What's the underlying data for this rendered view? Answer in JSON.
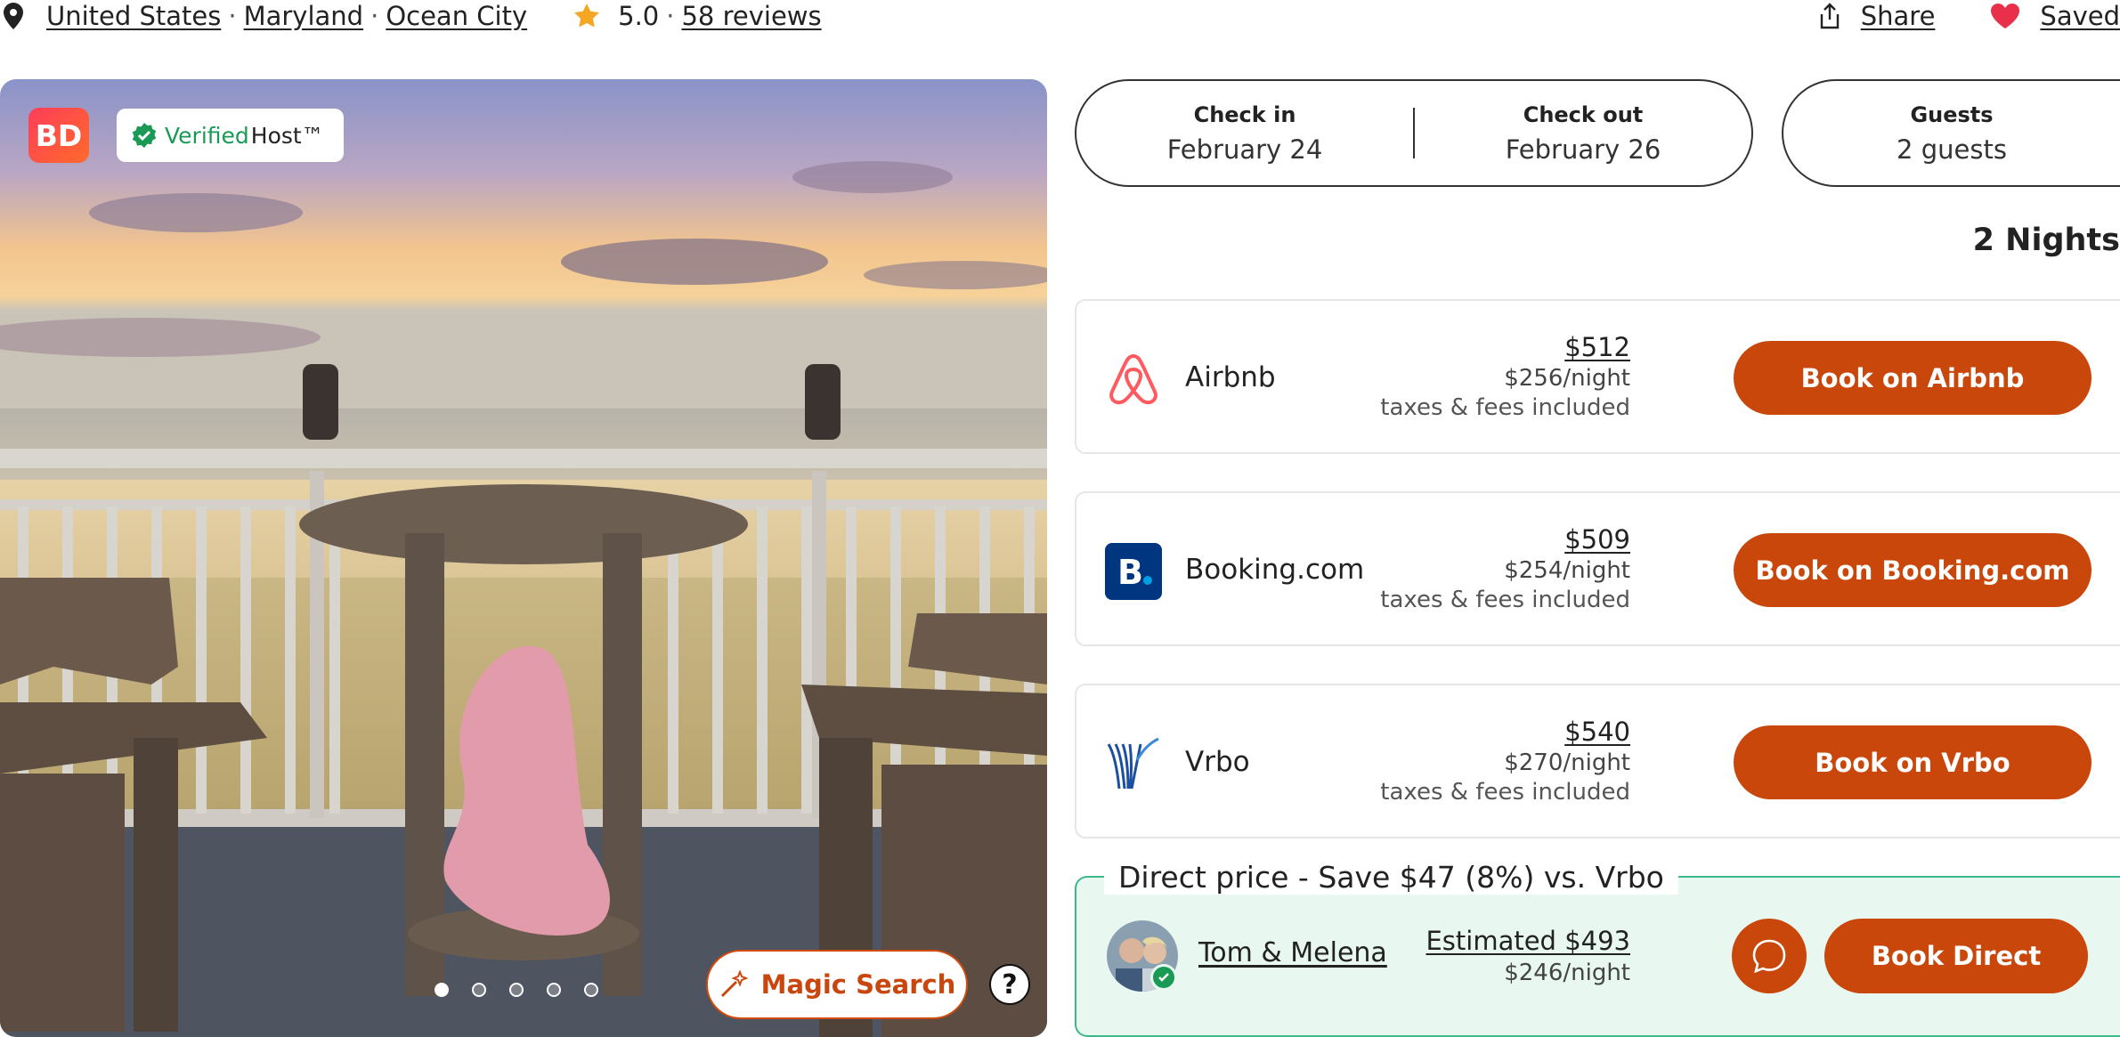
{
  "location": {
    "country": "United States",
    "state": "Maryland",
    "city": "Ocean City",
    "separator": "·"
  },
  "rating": {
    "score": "5.0",
    "separator": "·",
    "reviews": "58 reviews"
  },
  "actions": {
    "share": "Share",
    "saved": "Saved"
  },
  "photo": {
    "brand_badge": "BD",
    "verified_word": "Verified",
    "verified_suffix": "Host™",
    "dots_total": 5,
    "dots_active_index": 0,
    "magic_search": "Magic Search",
    "help": "?"
  },
  "booking": {
    "check_in_label": "Check in",
    "check_in_value": "February 24",
    "check_out_label": "Check out",
    "check_out_value": "February 26",
    "guests_label": "Guests",
    "guests_value": "2 guests",
    "nights": "2 Nights"
  },
  "offers": [
    {
      "platform": "Airbnb",
      "total": "$512",
      "per_night": "$256/night",
      "note": "taxes & fees included",
      "button": "Book on Airbnb",
      "icon": "airbnb-logo-icon",
      "color": "#ff5a5f"
    },
    {
      "platform": "Booking.com",
      "total": "$509",
      "per_night": "$254/night",
      "note": "taxes & fees included",
      "button": "Book on Booking.com",
      "icon": "booking-logo-icon",
      "color": "#003580"
    },
    {
      "platform": "Vrbo",
      "total": "$540",
      "per_night": "$270/night",
      "note": "taxes & fees included",
      "button": "Book on Vrbo",
      "icon": "vrbo-logo-icon",
      "color": "#1d4fa0"
    }
  ],
  "direct": {
    "title": "Direct price - Save $47 (8%) vs. Vrbo",
    "host": "Tom & Melena",
    "estimated": "Estimated $493",
    "per_night": "$246/night",
    "button": "Book Direct"
  },
  "colors": {
    "accent": "#c9470a",
    "verified_green": "#1a9a55",
    "direct_bg": "#e8f7f0",
    "direct_border": "#3cb98a",
    "star": "#f5a623",
    "heart": "#e8304a"
  }
}
